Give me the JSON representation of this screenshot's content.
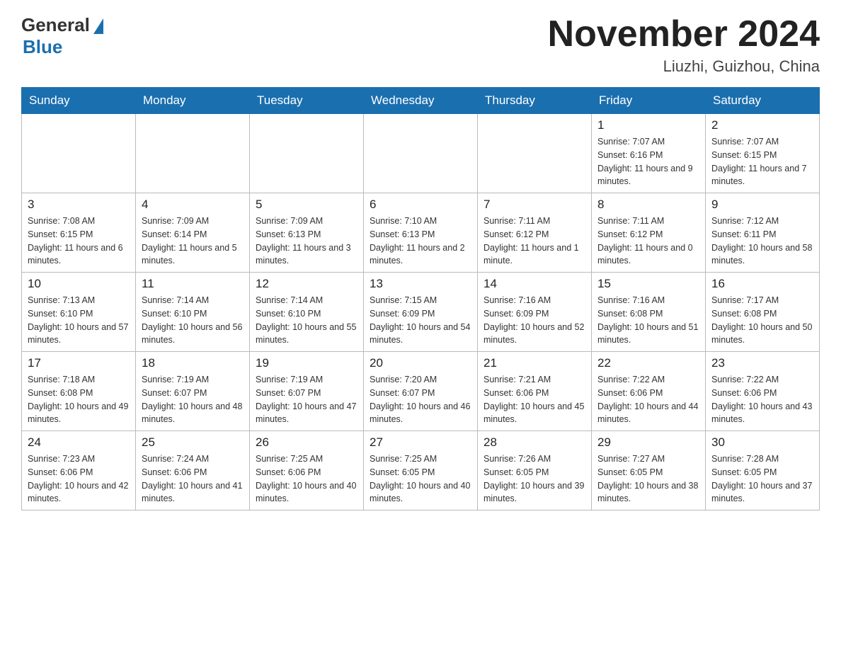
{
  "header": {
    "logo_general": "General",
    "logo_blue": "Blue",
    "title": "November 2024",
    "location": "Liuzhi, Guizhou, China"
  },
  "days_of_week": [
    "Sunday",
    "Monday",
    "Tuesday",
    "Wednesday",
    "Thursday",
    "Friday",
    "Saturday"
  ],
  "weeks": [
    [
      {
        "day": "",
        "info": ""
      },
      {
        "day": "",
        "info": ""
      },
      {
        "day": "",
        "info": ""
      },
      {
        "day": "",
        "info": ""
      },
      {
        "day": "",
        "info": ""
      },
      {
        "day": "1",
        "info": "Sunrise: 7:07 AM\nSunset: 6:16 PM\nDaylight: 11 hours and 9 minutes."
      },
      {
        "day": "2",
        "info": "Sunrise: 7:07 AM\nSunset: 6:15 PM\nDaylight: 11 hours and 7 minutes."
      }
    ],
    [
      {
        "day": "3",
        "info": "Sunrise: 7:08 AM\nSunset: 6:15 PM\nDaylight: 11 hours and 6 minutes."
      },
      {
        "day": "4",
        "info": "Sunrise: 7:09 AM\nSunset: 6:14 PM\nDaylight: 11 hours and 5 minutes."
      },
      {
        "day": "5",
        "info": "Sunrise: 7:09 AM\nSunset: 6:13 PM\nDaylight: 11 hours and 3 minutes."
      },
      {
        "day": "6",
        "info": "Sunrise: 7:10 AM\nSunset: 6:13 PM\nDaylight: 11 hours and 2 minutes."
      },
      {
        "day": "7",
        "info": "Sunrise: 7:11 AM\nSunset: 6:12 PM\nDaylight: 11 hours and 1 minute."
      },
      {
        "day": "8",
        "info": "Sunrise: 7:11 AM\nSunset: 6:12 PM\nDaylight: 11 hours and 0 minutes."
      },
      {
        "day": "9",
        "info": "Sunrise: 7:12 AM\nSunset: 6:11 PM\nDaylight: 10 hours and 58 minutes."
      }
    ],
    [
      {
        "day": "10",
        "info": "Sunrise: 7:13 AM\nSunset: 6:10 PM\nDaylight: 10 hours and 57 minutes."
      },
      {
        "day": "11",
        "info": "Sunrise: 7:14 AM\nSunset: 6:10 PM\nDaylight: 10 hours and 56 minutes."
      },
      {
        "day": "12",
        "info": "Sunrise: 7:14 AM\nSunset: 6:10 PM\nDaylight: 10 hours and 55 minutes."
      },
      {
        "day": "13",
        "info": "Sunrise: 7:15 AM\nSunset: 6:09 PM\nDaylight: 10 hours and 54 minutes."
      },
      {
        "day": "14",
        "info": "Sunrise: 7:16 AM\nSunset: 6:09 PM\nDaylight: 10 hours and 52 minutes."
      },
      {
        "day": "15",
        "info": "Sunrise: 7:16 AM\nSunset: 6:08 PM\nDaylight: 10 hours and 51 minutes."
      },
      {
        "day": "16",
        "info": "Sunrise: 7:17 AM\nSunset: 6:08 PM\nDaylight: 10 hours and 50 minutes."
      }
    ],
    [
      {
        "day": "17",
        "info": "Sunrise: 7:18 AM\nSunset: 6:08 PM\nDaylight: 10 hours and 49 minutes."
      },
      {
        "day": "18",
        "info": "Sunrise: 7:19 AM\nSunset: 6:07 PM\nDaylight: 10 hours and 48 minutes."
      },
      {
        "day": "19",
        "info": "Sunrise: 7:19 AM\nSunset: 6:07 PM\nDaylight: 10 hours and 47 minutes."
      },
      {
        "day": "20",
        "info": "Sunrise: 7:20 AM\nSunset: 6:07 PM\nDaylight: 10 hours and 46 minutes."
      },
      {
        "day": "21",
        "info": "Sunrise: 7:21 AM\nSunset: 6:06 PM\nDaylight: 10 hours and 45 minutes."
      },
      {
        "day": "22",
        "info": "Sunrise: 7:22 AM\nSunset: 6:06 PM\nDaylight: 10 hours and 44 minutes."
      },
      {
        "day": "23",
        "info": "Sunrise: 7:22 AM\nSunset: 6:06 PM\nDaylight: 10 hours and 43 minutes."
      }
    ],
    [
      {
        "day": "24",
        "info": "Sunrise: 7:23 AM\nSunset: 6:06 PM\nDaylight: 10 hours and 42 minutes."
      },
      {
        "day": "25",
        "info": "Sunrise: 7:24 AM\nSunset: 6:06 PM\nDaylight: 10 hours and 41 minutes."
      },
      {
        "day": "26",
        "info": "Sunrise: 7:25 AM\nSunset: 6:06 PM\nDaylight: 10 hours and 40 minutes."
      },
      {
        "day": "27",
        "info": "Sunrise: 7:25 AM\nSunset: 6:05 PM\nDaylight: 10 hours and 40 minutes."
      },
      {
        "day": "28",
        "info": "Sunrise: 7:26 AM\nSunset: 6:05 PM\nDaylight: 10 hours and 39 minutes."
      },
      {
        "day": "29",
        "info": "Sunrise: 7:27 AM\nSunset: 6:05 PM\nDaylight: 10 hours and 38 minutes."
      },
      {
        "day": "30",
        "info": "Sunrise: 7:28 AM\nSunset: 6:05 PM\nDaylight: 10 hours and 37 minutes."
      }
    ]
  ]
}
